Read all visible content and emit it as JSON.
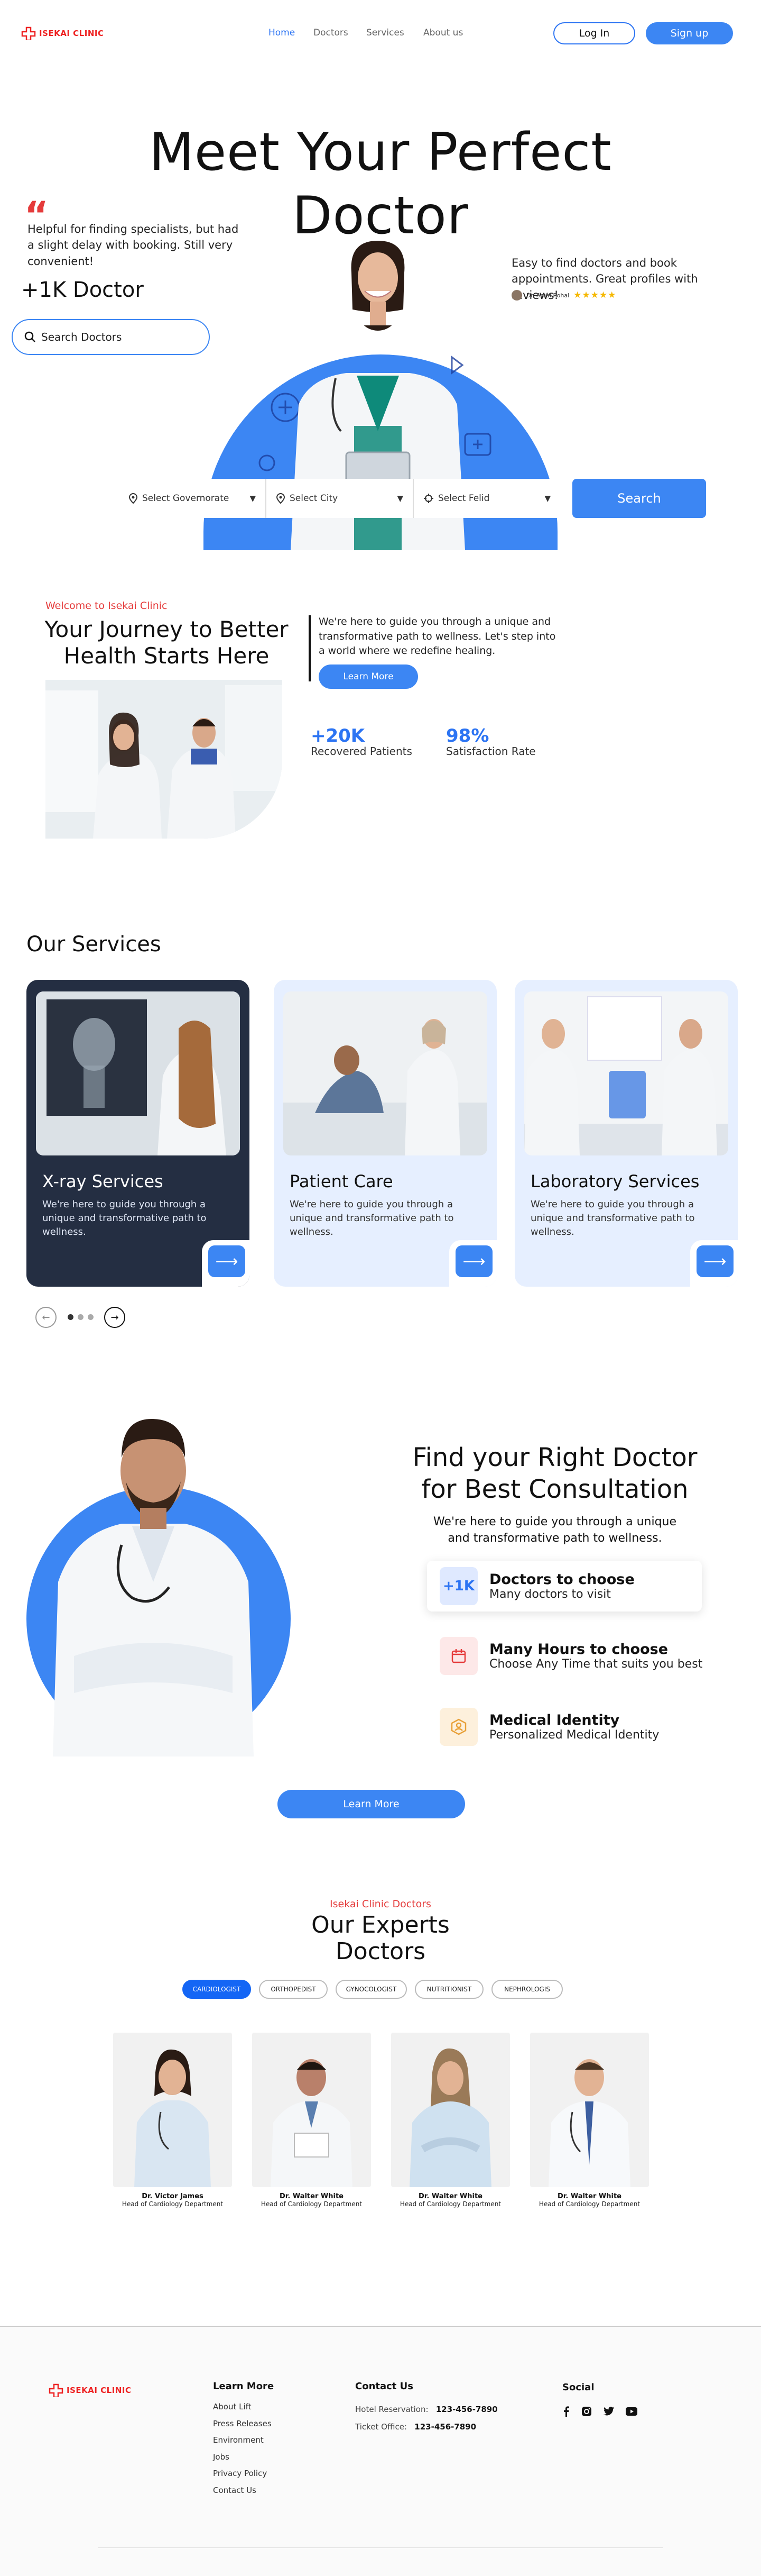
{
  "brand": {
    "name": "ISEKAI CLINIC",
    "colors": {
      "primary": "#3c86f3",
      "accent": "#e53b3b",
      "dark_card": "#242e42",
      "light_card": "#e6efff"
    }
  },
  "nav": {
    "links": [
      "Home",
      "Doctors",
      "Services",
      "About us"
    ],
    "login": "Log In",
    "signup": "Sign up"
  },
  "hero": {
    "title_line1": "Meet Your Perfect",
    "title_line2": "Doctor",
    "quote_mark": "“",
    "left_review": "Helpful for finding specialists, but had a slight delay with booking. Still very convenient!",
    "doctor_count": "+1K Doctor",
    "search_placeholder": "Search Doctors",
    "right_review": "Easy to find doctors and book appointments. Great profiles with reviews!",
    "reviewer": "Dr. Amal Rohal",
    "stars": "★★★★★",
    "rating": 5,
    "filters": [
      "Select Governorate",
      "Select City",
      "Select Felid"
    ],
    "search_button": "Search"
  },
  "journey": {
    "subtitle": "Welcome to Isekai Clinic",
    "title_line1": "Your Journey to Better",
    "title_line2": "Health Starts Here",
    "text": "We're here to guide you through a unique and transformative path to wellness. Let's step into a world where we redefine healing.",
    "button": "Learn More",
    "stats": [
      {
        "value": "+20K",
        "label": "Recovered Patients"
      },
      {
        "value": "98%",
        "label": "Satisfaction Rate"
      }
    ]
  },
  "services": {
    "heading": "Our Services",
    "cards": [
      {
        "title": "X-ray Services",
        "desc": "We're here to guide you through a unique and transformative path to wellness."
      },
      {
        "title": "Patient Care",
        "desc": "We're here to guide you through a unique and transformative path to wellness."
      },
      {
        "title": "Laboratory Services",
        "desc": "We're here to guide you through a unique and transformative path to wellness."
      }
    ],
    "arrow": "⟶",
    "prev": "←",
    "next": "→",
    "slide_count": 3,
    "current_slide": 1
  },
  "find": {
    "title_line1": "Find your Right Doctor",
    "title_line2": "for Best Consultation",
    "subtitle": "We're here to guide you through a unique and transformative path to wellness.",
    "features": [
      {
        "icon": "+1K",
        "title": "Doctors to choose",
        "sub": "Many doctors to visit"
      },
      {
        "icon": "calendar-icon",
        "title": "Many Hours to choose",
        "sub": "Choose Any Time that suits you best"
      },
      {
        "icon": "identity-icon",
        "title": "Medical Identity",
        "sub": "Personalized Medical Identity"
      }
    ],
    "button": "Learn More"
  },
  "experts": {
    "subtitle": "Isekai Clinic Doctors",
    "title_line1": "Our Experts",
    "title_line2": "Doctors",
    "tabs": [
      "CARDIOLOGIST",
      "ORTHOPEDIST",
      "GYNOCOLOGIST",
      "NUTRITIONIST",
      "NEPHROLOGIS"
    ],
    "active_tab": "CARDIOLOGIST",
    "doctors": [
      {
        "name": "Dr. Victor James",
        "dept": "Head of Cardiology Department"
      },
      {
        "name": "Dr. Walter White",
        "dept": "Head of Cardiology Department"
      },
      {
        "name": "Dr. Walter White",
        "dept": "Head of Cardiology Department"
      },
      {
        "name": "Dr. Walter White",
        "dept": "Head of Cardiology Department"
      }
    ]
  },
  "footer": {
    "learn_heading": "Learn More",
    "learn_links": [
      "About Lift",
      "Press Releases",
      "Environment",
      "Jobs",
      "Privacy Policy",
      "Contact Us"
    ],
    "contact_heading": "Contact Us",
    "hotel_label": "Hotel Reservation:",
    "hotel_phone": "123-456-7890",
    "ticket_label": "Ticket Office:",
    "ticket_phone": "123-456-7890",
    "social_heading": "Social",
    "social_icons": [
      "facebook-icon",
      "instagram-icon",
      "twitter-icon",
      "youtube-icon"
    ]
  }
}
